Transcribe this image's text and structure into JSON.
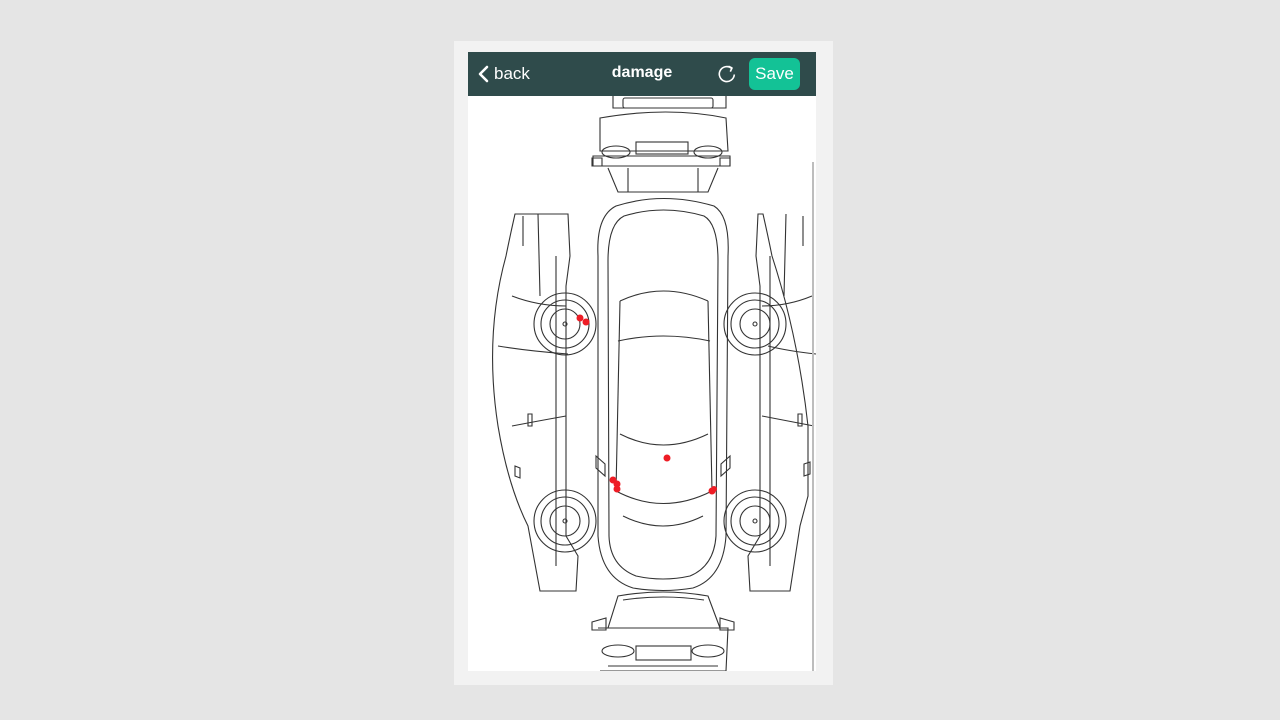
{
  "header": {
    "back_label": "back",
    "title": "damage",
    "save_label": "Save"
  },
  "icons": {
    "back": "chevron-left-icon",
    "refresh": "refresh-icon"
  },
  "colors": {
    "header_bg": "#2f4b4b",
    "save_bg": "#13c296",
    "damage_mark": "#ee1c25"
  },
  "diagram": {
    "views": [
      "rear",
      "left-side",
      "top",
      "right-side",
      "front"
    ],
    "damage_mark_count": 8
  }
}
